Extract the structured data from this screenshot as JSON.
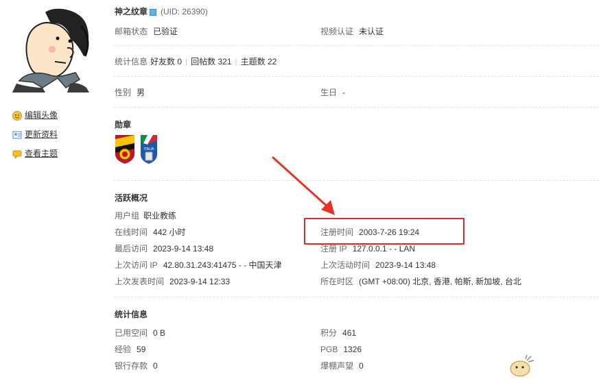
{
  "profile": {
    "username": "神之纹章",
    "uid": "(UID: 26390)",
    "email_label": "邮箱状态",
    "email_value": "已验证",
    "video_label": "视频认证",
    "video_value": "未认证",
    "stats_label": "统计信息",
    "friends": "好友数 0",
    "replies": "回帖数 321",
    "topics": "主题数 22",
    "gender_label": "性别",
    "gender_value": "男",
    "birthday_label": "生日",
    "birthday_value": "-"
  },
  "sidebar": {
    "edit_avatar": "编辑头像",
    "update_profile": "更新资料",
    "view_topics": "查看主题"
  },
  "medals": {
    "title": "勋章",
    "items": [
      "spain-badge-icon",
      "italia-badge-icon"
    ],
    "italia_text": "ITALIA"
  },
  "activity": {
    "title": "活跃概况",
    "group_label": "用户组",
    "group_value": "职业教练",
    "online_label": "在线时间",
    "online_value": "442 小时",
    "reg_label": "注册时间",
    "reg_value": "2003-7-26 19:24",
    "last_visit_label": "最后访问",
    "last_visit_value": "2023-9-14 13:48",
    "reg_ip_label": "注册 IP",
    "reg_ip_value": "127.0.0.1 - - LAN",
    "last_ip_label": "上次访问 IP",
    "last_ip_value": "42.80.31.243:41475 - - 中国天津",
    "last_active_label": "上次活动时间",
    "last_active_value": "2023-9-14 13:48",
    "last_post_label": "上次发表时间",
    "last_post_value": "2023-9-14 12:33",
    "tz_label": "所在时区",
    "tz_value": "(GMT +08:00) 北京, 香港, 帕斯, 新加坡, 台北"
  },
  "stats": {
    "title": "统计信息",
    "space_label": "已用空间",
    "space_value": "0 B",
    "credits_label": "积分",
    "credits_value": "461",
    "exp_label": "经验",
    "exp_value": "59",
    "pgb_label": "PGB",
    "pgb_value": "1326",
    "bank_label": "银行存款",
    "bank_value": "0",
    "fame_label": "爆棚声望",
    "fame_value": "0"
  },
  "colors": {
    "highlight_box": "#e0282a",
    "arrow": "#e53326",
    "link": "#333333"
  }
}
